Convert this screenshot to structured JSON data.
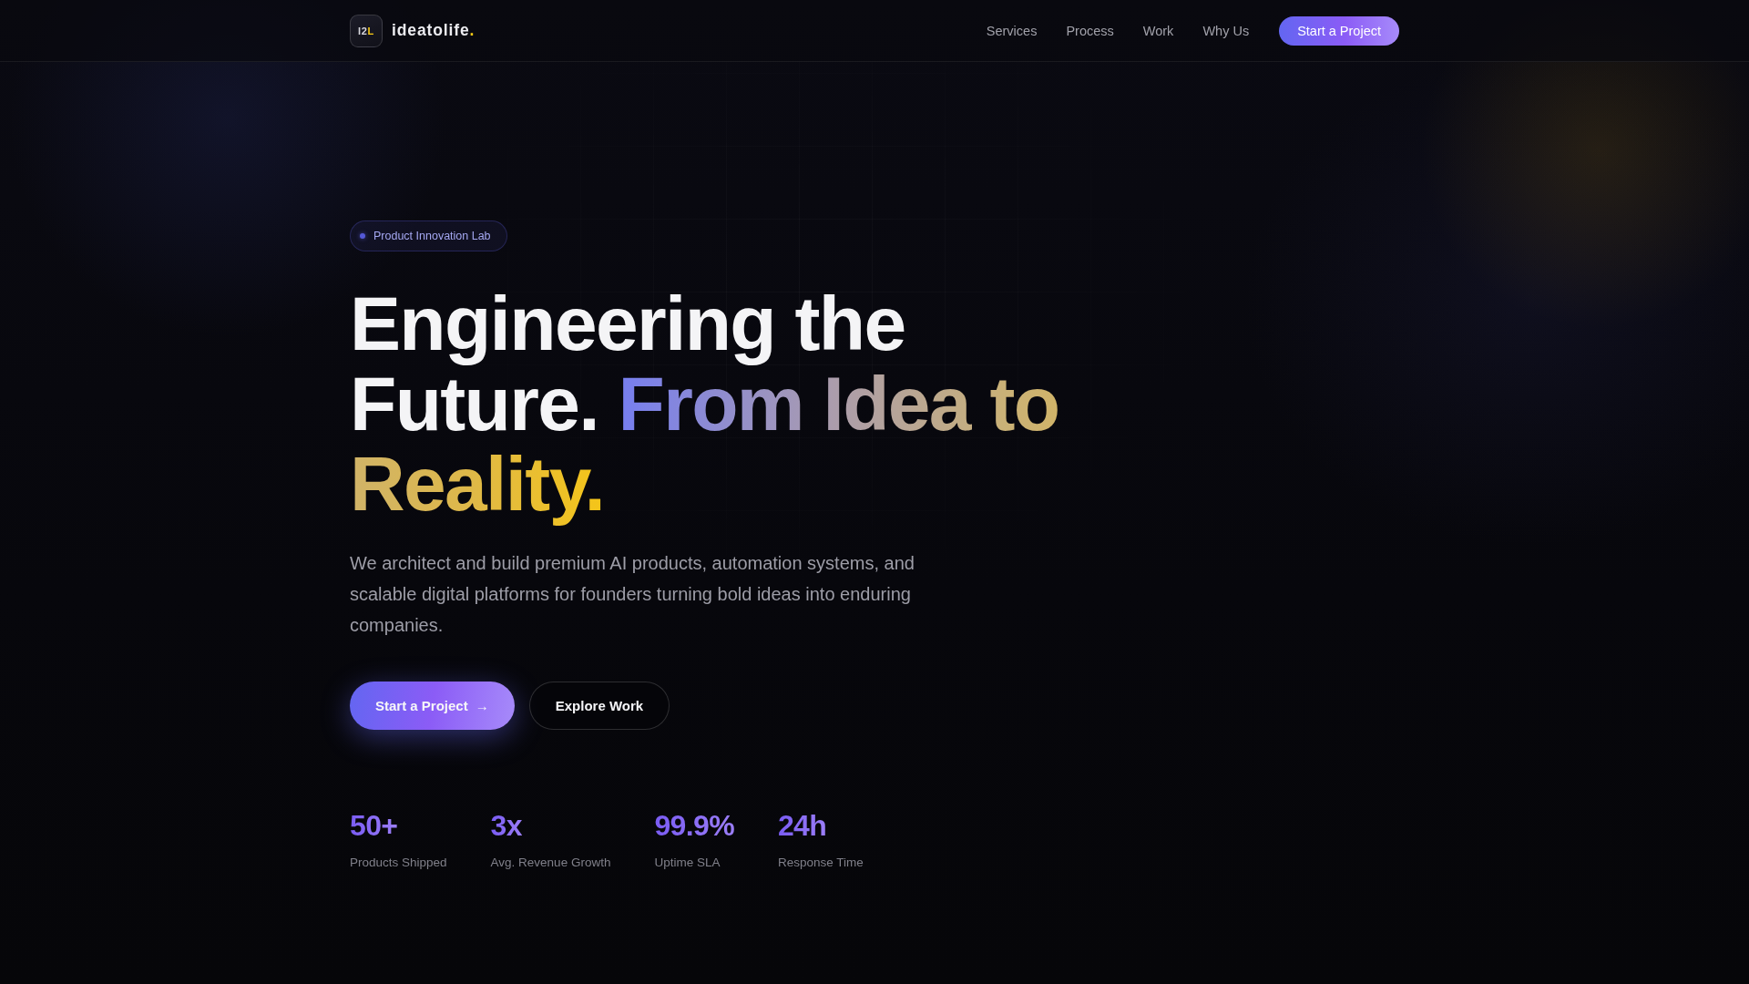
{
  "nav": {
    "logo": {
      "mark": "I2",
      "mark_accent": "L"
    },
    "brand": {
      "name": "ideatolife",
      "accent": "."
    },
    "links": [
      {
        "label": "Services"
      },
      {
        "label": "Process"
      },
      {
        "label": "Work"
      },
      {
        "label": "Why Us"
      }
    ],
    "cta": {
      "label": "Start a Project"
    }
  },
  "hero": {
    "badge": {
      "label": "Product Innovation Lab"
    },
    "headline": {
      "text": "Engineering the Future.",
      "highlight": "From Idea to Reality."
    },
    "description": "We architect and build premium AI products, automation systems, and scalable digital platforms for founders turning bold ideas into enduring companies.",
    "actions": [
      {
        "kind": "primary",
        "label": "Start a Project",
        "icon": "→"
      },
      {
        "kind": "secondary",
        "label": "Explore Work"
      }
    ],
    "stats": [
      {
        "value": "50+",
        "label": "Products Shipped"
      },
      {
        "value": "3x",
        "label": "Avg. Revenue Growth"
      },
      {
        "value": "99.9%",
        "label": "Uptime SLA"
      },
      {
        "value": "24h",
        "label": "Response Time"
      }
    ]
  }
}
